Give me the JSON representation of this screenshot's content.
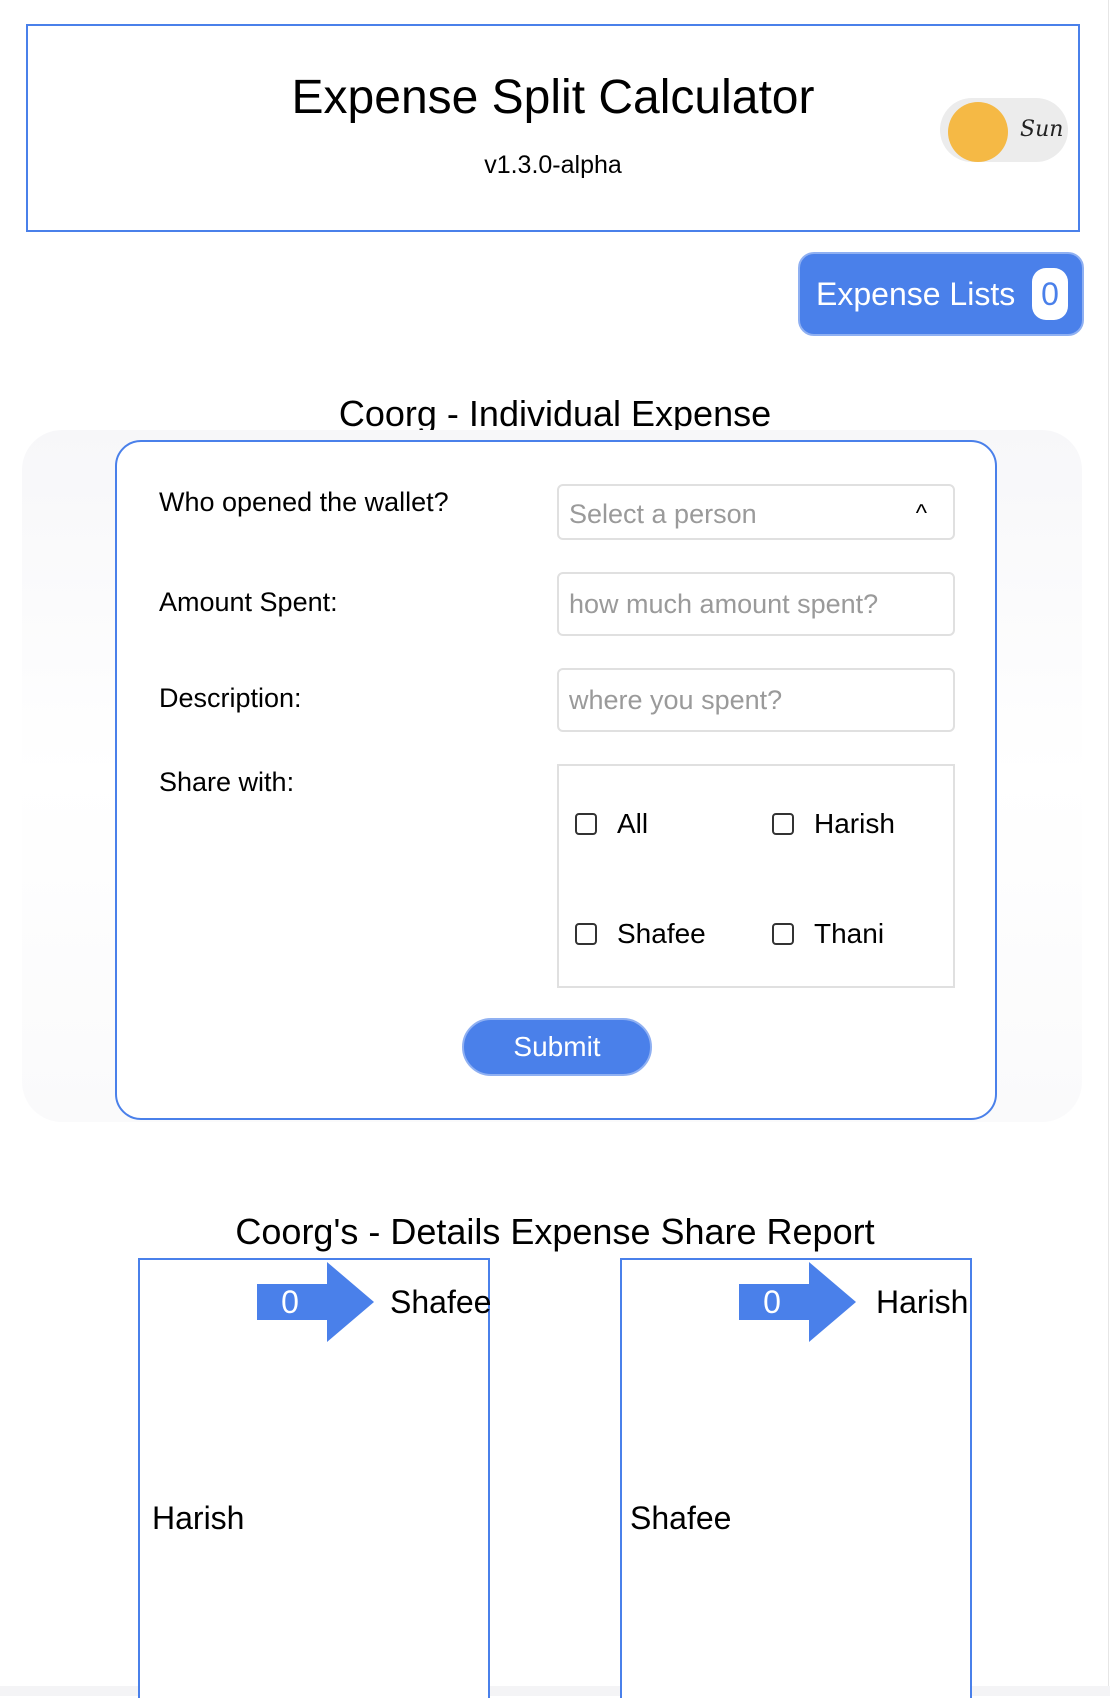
{
  "header": {
    "title": "Expense Split Calculator",
    "version": "v1.3.0-alpha",
    "theme_toggle_label": "Sun"
  },
  "expense_lists": {
    "label": "Expense Lists",
    "count": "0"
  },
  "individual_expense": {
    "title": "Coorg - Individual Expense",
    "wallet_label": "Who opened the wallet?",
    "wallet_select_placeholder": "Select a person",
    "wallet_select_chevron": "^",
    "amount_label": "Amount Spent:",
    "amount_placeholder": "how much amount spent?",
    "description_label": "Description:",
    "description_placeholder": "where you spent?",
    "share_label": "Share with:",
    "share_options": [
      "All",
      "Harish",
      "Shafee",
      "Thani"
    ],
    "submit_label": "Submit"
  },
  "report": {
    "title": "Coorg's - Details Expense Share Report",
    "cards": [
      {
        "from": "Harish",
        "amount": "0",
        "to": "Shafee"
      },
      {
        "from": "Shafee",
        "amount": "0",
        "to": "Harish"
      }
    ]
  },
  "colors": {
    "accent": "#4a80ea",
    "sun": "#f5b945"
  }
}
